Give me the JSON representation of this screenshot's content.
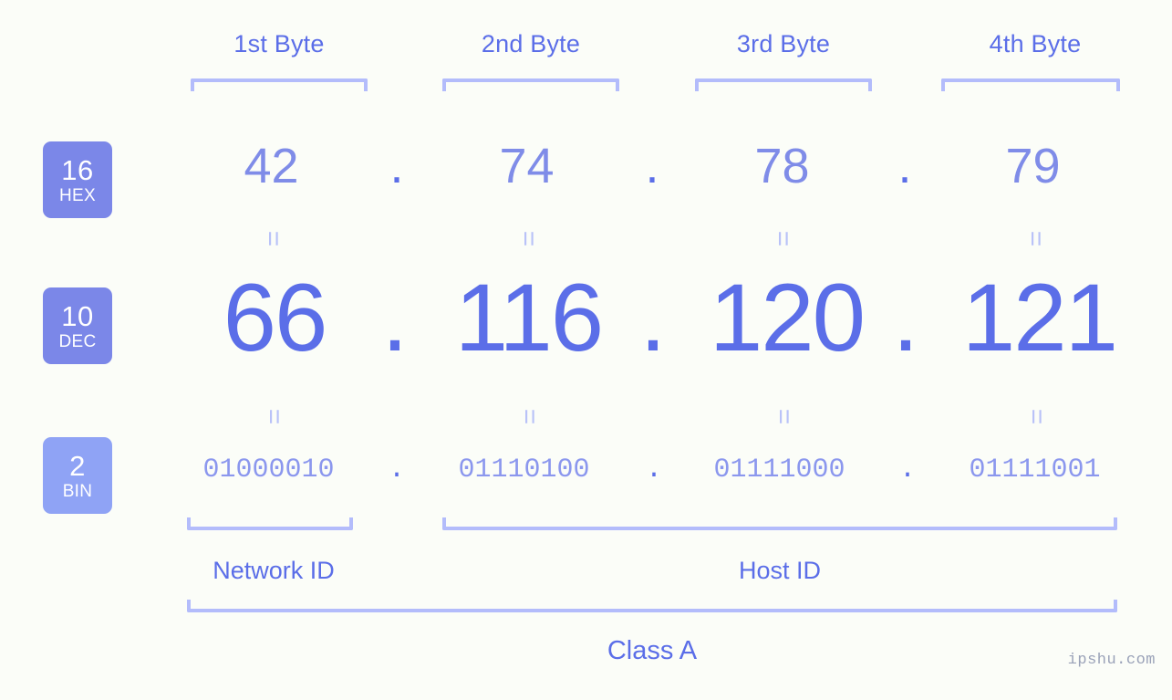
{
  "background_color": "#fbfdf8",
  "accent_color": "#5b6ee8",
  "bracket_color": "#b3bcfb",
  "byte_headers": [
    {
      "label": "1st Byte"
    },
    {
      "label": "2nd Byte"
    },
    {
      "label": "3rd Byte"
    },
    {
      "label": "4th Byte"
    }
  ],
  "bases": [
    {
      "number": "16",
      "name": "HEX",
      "badge_color": "#7b87e8"
    },
    {
      "number": "10",
      "name": "DEC",
      "badge_color": "#7b87e8"
    },
    {
      "number": "2",
      "name": "BIN",
      "badge_color": "#8fa3f5"
    }
  ],
  "rows": {
    "hex": {
      "values": [
        "42",
        "74",
        "78",
        "79"
      ],
      "separator": "."
    },
    "dec": {
      "values": [
        "66",
        "116",
        "120",
        "121"
      ],
      "separator": "."
    },
    "bin": {
      "values": [
        "01000010",
        "01110100",
        "01111000",
        "01111001"
      ],
      "separator": "."
    }
  },
  "equals_glyph": "=",
  "segments": {
    "network_id": "Network ID",
    "host_id": "Host ID"
  },
  "class_label": "Class A",
  "watermark": "ipshu.com"
}
